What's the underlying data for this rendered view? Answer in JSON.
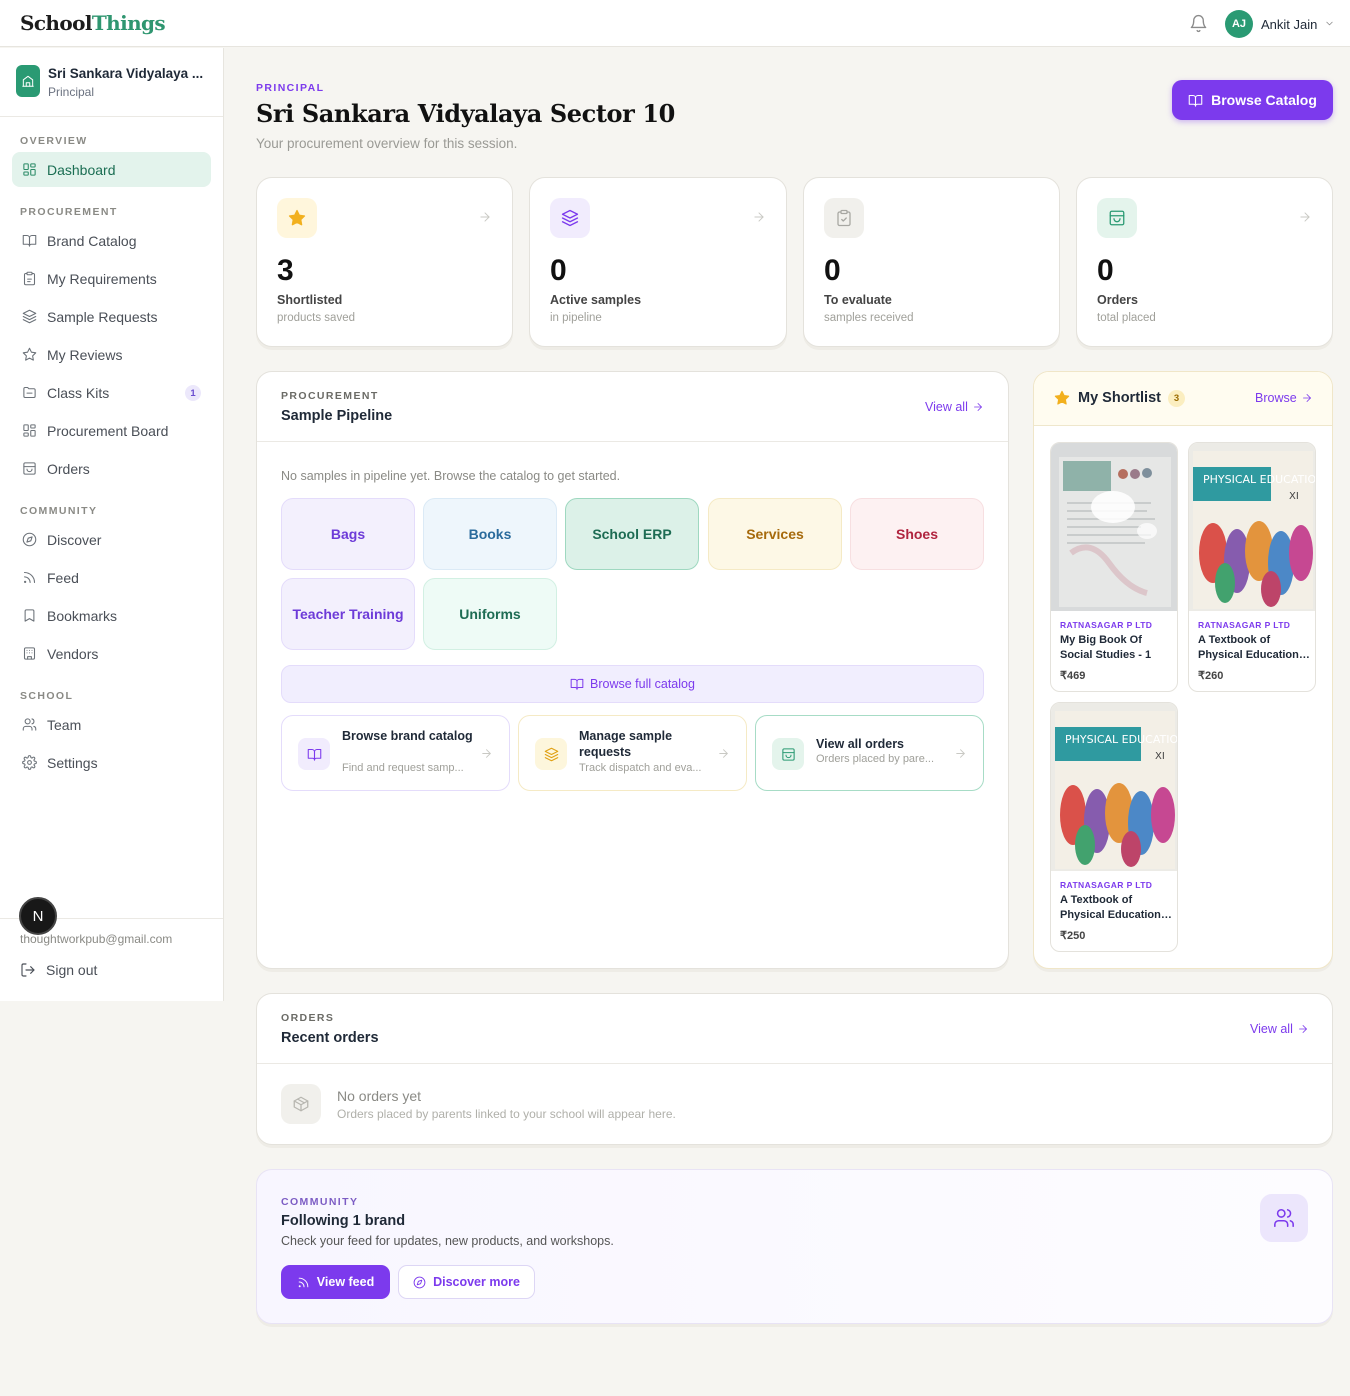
{
  "brand": {
    "part1": "School",
    "part2": "Things"
  },
  "user": {
    "initials": "AJ",
    "name": "Ankit Jain"
  },
  "sidebar": {
    "school_name": "Sri Sankara Vidyalaya ...",
    "school_role": "Principal",
    "sections": {
      "overview": "OVERVIEW",
      "procurement": "PROCUREMENT",
      "community": "COMMUNITY",
      "school": "SCHOOL"
    },
    "items": {
      "dashboard": "Dashboard",
      "brand_catalog": "Brand Catalog",
      "my_requirements": "My Requirements",
      "sample_requests": "Sample Requests",
      "my_reviews": "My Reviews",
      "class_kits": "Class Kits",
      "class_kits_badge": "1",
      "procurement_board": "Procurement Board",
      "orders": "Orders",
      "discover": "Discover",
      "feed": "Feed",
      "bookmarks": "Bookmarks",
      "vendors": "Vendors",
      "team": "Team",
      "settings": "Settings"
    },
    "email": "thoughtworkpub@gmail.com",
    "sign_out": "Sign out",
    "dev_badge": "N"
  },
  "page": {
    "eyebrow": "PRINCIPAL",
    "title": "Sri Sankara Vidyalaya Sector 10",
    "subtitle": "Your procurement overview for this session.",
    "browse_catalog": "Browse Catalog"
  },
  "stats": [
    {
      "value": "3",
      "label": "Shortlisted",
      "sub": "products saved",
      "icon": "star-icon",
      "color": "#f2b01e"
    },
    {
      "value": "0",
      "label": "Active samples",
      "sub": "in pipeline",
      "icon": "layers-icon",
      "color": "#7c3aed"
    },
    {
      "value": "0",
      "label": "To evaluate",
      "sub": "samples received",
      "icon": "clipboard-icon",
      "color": "#9ca3af"
    },
    {
      "value": "0",
      "label": "Orders",
      "sub": "total placed",
      "icon": "shopping-bag-icon",
      "color": "#2a9a73"
    }
  ],
  "pipeline": {
    "eyebrow": "PROCUREMENT",
    "title": "Sample Pipeline",
    "view_all": "View all",
    "empty": "No samples in pipeline yet. Browse the catalog to get started.",
    "categories": [
      "Bags",
      "Books",
      "School ERP",
      "Services",
      "Shoes",
      "Teacher Training",
      "Uniforms"
    ],
    "browse_full": "Browse full catalog",
    "actions": [
      {
        "title": "Browse brand catalog",
        "sub": "Find and request samp..."
      },
      {
        "title": "Manage sample requests",
        "sub": "Track dispatch and eva..."
      },
      {
        "title": "View all orders",
        "sub": "Orders placed by pare..."
      }
    ]
  },
  "shortlist": {
    "title": "My Shortlist",
    "count": "3",
    "browse": "Browse",
    "products": [
      {
        "brand": "RATNASAGAR P LTD",
        "name": "My Big Book Of Social Studies - 1",
        "price": "₹469"
      },
      {
        "brand": "RATNASAGAR P LTD",
        "name": "A Textbook of Physical Education ...",
        "price": "₹260",
        "cover_title": "PHYSICAL EDUCATION",
        "cover_grade": "XI"
      },
      {
        "brand": "RATNASAGAR P LTD",
        "name": "A Textbook of Physical Education ...",
        "price": "₹250",
        "cover_title": "PHYSICAL EDUCATION",
        "cover_grade": "XI"
      }
    ]
  },
  "orders": {
    "eyebrow": "ORDERS",
    "title": "Recent orders",
    "view_all": "View all",
    "empty_title": "No orders yet",
    "empty_sub": "Orders placed by parents linked to your school will appear here."
  },
  "community": {
    "eyebrow": "COMMUNITY",
    "title": "Following 1 brand",
    "sub": "Check your feed for updates, new products, and workshops.",
    "view_feed": "View feed",
    "discover_more": "Discover more"
  }
}
